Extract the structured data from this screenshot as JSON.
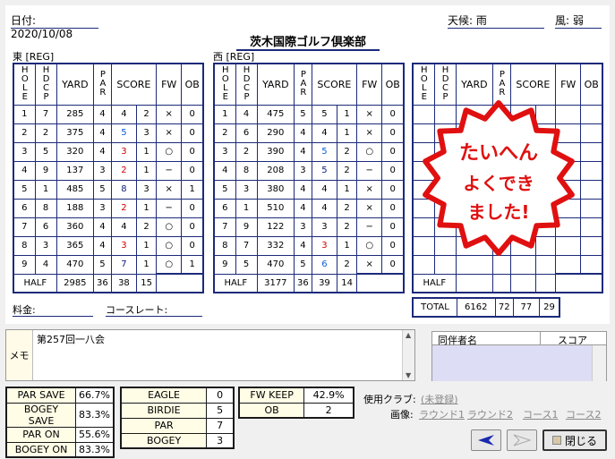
{
  "header": {
    "date_label": "日付: 2020/10/08",
    "weather_label": "天候: 雨",
    "wind_label": "風: 弱",
    "club_name": "茨木国際ゴルフ倶楽部"
  },
  "tables": {
    "east_title": "東 [REG]",
    "west_title": "西 [REG]",
    "col_hole": "HOLE",
    "col_hdcp": "HDCP",
    "col_yard": "YARD",
    "col_par": "PAR",
    "col_score": "SCORE",
    "col_fw": "FW",
    "col_ob": "OB",
    "half_label": "HALF",
    "total_label": "TOTAL",
    "east_rows": [
      [
        "1",
        "7",
        "285",
        "4",
        "4",
        "2",
        "×",
        "0"
      ],
      [
        "2",
        "2",
        "375",
        "4",
        "5",
        "3",
        "×",
        "0"
      ],
      [
        "3",
        "5",
        "320",
        "4",
        "3",
        "1",
        "○",
        "0"
      ],
      [
        "4",
        "9",
        "137",
        "3",
        "2",
        "1",
        "−",
        "0"
      ],
      [
        "5",
        "1",
        "485",
        "5",
        "8",
        "3",
        "×",
        "1"
      ],
      [
        "6",
        "8",
        "188",
        "3",
        "2",
        "1",
        "−",
        "0"
      ],
      [
        "7",
        "6",
        "360",
        "4",
        "4",
        "2",
        "○",
        "0"
      ],
      [
        "8",
        "3",
        "365",
        "4",
        "3",
        "1",
        "○",
        "0"
      ],
      [
        "9",
        "4",
        "470",
        "5",
        "7",
        "1",
        "○",
        "1"
      ]
    ],
    "east_half": [
      "2985",
      "36",
      "38",
      "15"
    ],
    "west_rows": [
      [
        "1",
        "4",
        "475",
        "5",
        "5",
        "1",
        "×",
        "0"
      ],
      [
        "2",
        "6",
        "290",
        "4",
        "4",
        "1",
        "×",
        "0"
      ],
      [
        "3",
        "2",
        "390",
        "4",
        "5",
        "2",
        "○",
        "0"
      ],
      [
        "4",
        "8",
        "208",
        "3",
        "5",
        "2",
        "−",
        "0"
      ],
      [
        "5",
        "3",
        "380",
        "4",
        "4",
        "1",
        "×",
        "0"
      ],
      [
        "6",
        "1",
        "510",
        "4",
        "4",
        "2",
        "×",
        "0"
      ],
      [
        "7",
        "9",
        "122",
        "3",
        "3",
        "2",
        "−",
        "0"
      ],
      [
        "8",
        "7",
        "332",
        "4",
        "3",
        "1",
        "○",
        "0"
      ],
      [
        "9",
        "5",
        "470",
        "5",
        "6",
        "2",
        "×",
        "0"
      ]
    ],
    "west_half": [
      "3177",
      "36",
      "39",
      "14"
    ],
    "total": [
      "6162",
      "72",
      "77",
      "29"
    ],
    "stamp_text": [
      "たいへん",
      "よくできました!"
    ]
  },
  "fees": {
    "fee_label": "料金:",
    "course_rate_label": "コースレート:"
  },
  "memo": {
    "label": "メモ",
    "text": "第257回一八会"
  },
  "companions": {
    "col_name": "同伴者名",
    "col_score": "スコア"
  },
  "stats": {
    "left": [
      [
        "PAR SAVE",
        "66.7%"
      ],
      [
        "BOGEY SAVE",
        "83.3%"
      ],
      [
        "PAR ON",
        "55.6%"
      ],
      [
        "BOGEY ON",
        "83.3%"
      ]
    ],
    "mid": [
      [
        "EAGLE",
        "0"
      ],
      [
        "BIRDIE",
        "5"
      ],
      [
        "PAR",
        "7"
      ],
      [
        "BOGEY",
        "3"
      ]
    ],
    "right": [
      [
        "FW KEEP",
        "42.9%"
      ],
      [
        "OB",
        "2"
      ]
    ]
  },
  "links": {
    "clubs_label": "使用クラブ:",
    "clubs_link": "(未登録)",
    "image_label": "画像:",
    "round1": "ラウンド1",
    "round2": "ラウンド2",
    "course1": "コース1",
    "course2": "コース2"
  },
  "buttons": {
    "close": "閉じる"
  },
  "colors": {
    "grid": "#1c2a7a",
    "red": "#d00000",
    "blue": "#0b5ed7",
    "stamp": "#e01010"
  }
}
